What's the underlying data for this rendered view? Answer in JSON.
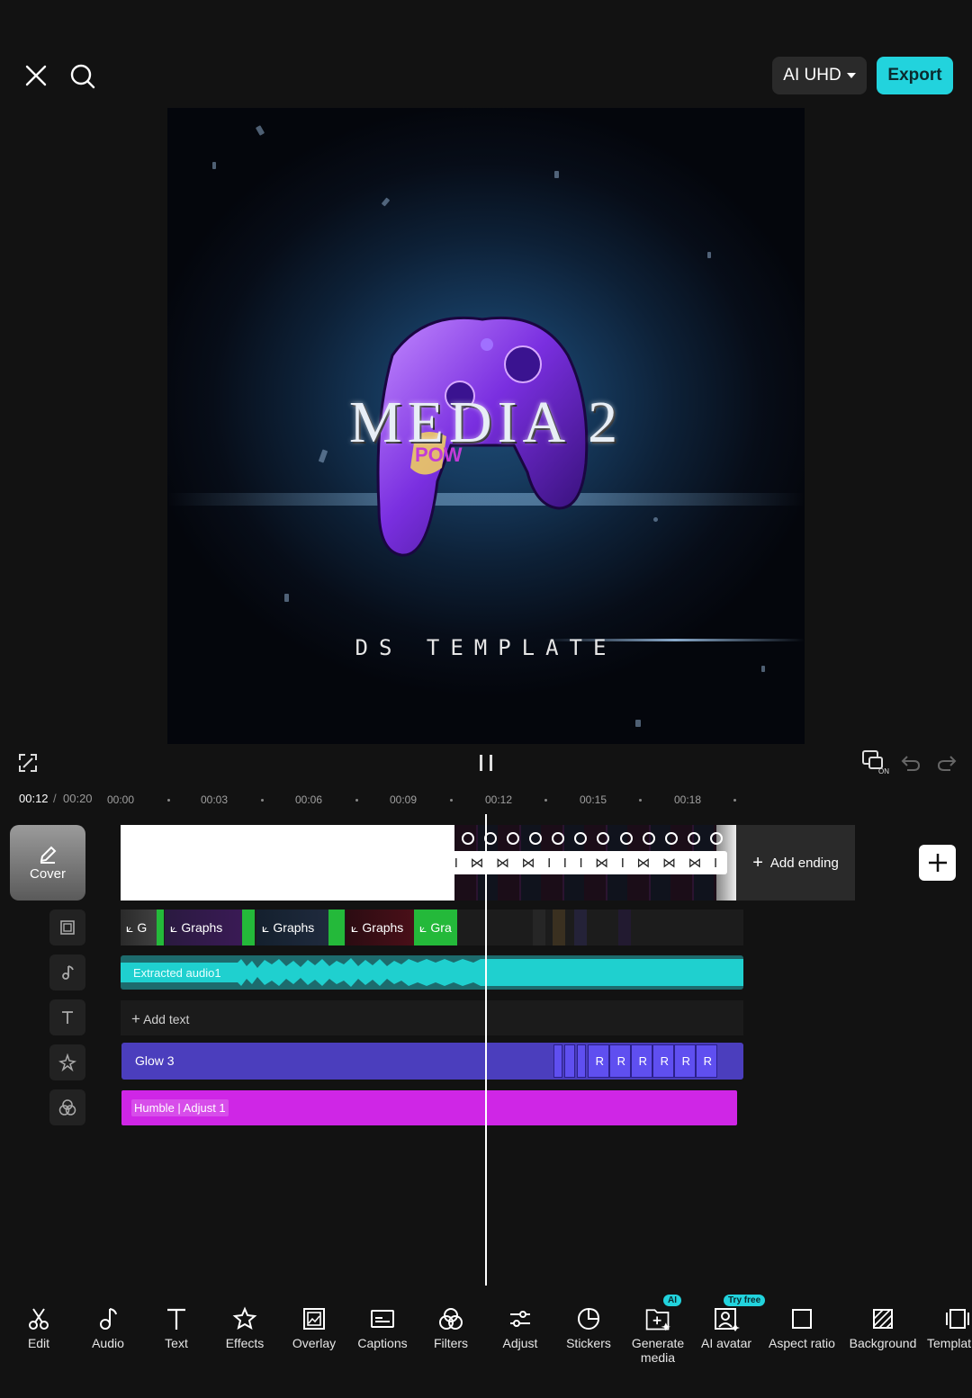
{
  "header": {
    "quality_label": "AI UHD",
    "export_label": "Export"
  },
  "preview": {
    "title_text": "MEDIA 2",
    "subtitle_text": "DS TEMPLATE"
  },
  "timeline": {
    "current_time": "00:12",
    "separator": "/",
    "total_time": "00:20",
    "ruler_ticks": [
      "00:00",
      "00:03",
      "00:06",
      "00:09",
      "00:12",
      "00:15",
      "00:18"
    ],
    "cover_label": "Cover",
    "add_ending_label": "Add ending",
    "overlay_clips": [
      "G",
      "Graphs",
      "Graphs",
      "Graphs",
      "Gra"
    ],
    "audio_label": "Extracted audio1",
    "add_text_label": "Add text",
    "effect_label": "Glow 3",
    "effect_marker": "R",
    "adjust_label": "Humble | Adjust 1"
  },
  "toolbar": {
    "items": [
      {
        "label": "Edit",
        "icon": "scissors-icon"
      },
      {
        "label": "Audio",
        "icon": "music-note-icon"
      },
      {
        "label": "Text",
        "icon": "text-t-icon"
      },
      {
        "label": "Effects",
        "icon": "star-sparkle-icon"
      },
      {
        "label": "Overlay",
        "icon": "overlay-image-icon"
      },
      {
        "label": "Captions",
        "icon": "captions-icon"
      },
      {
        "label": "Filters",
        "icon": "filters-circles-icon"
      },
      {
        "label": "Adjust",
        "icon": "sliders-icon"
      },
      {
        "label": "Stickers",
        "icon": "sticker-icon"
      },
      {
        "label": "Generate media",
        "icon": "generate-media-icon"
      },
      {
        "label": "AI avatar",
        "icon": "ai-avatar-icon"
      },
      {
        "label": "Aspect ratio",
        "icon": "aspect-ratio-icon"
      },
      {
        "label": "Background",
        "icon": "background-icon"
      },
      {
        "label": "Templat",
        "icon": "template-icon"
      }
    ],
    "ai_badge": "AI",
    "try_free_badge": "Try free"
  },
  "colors": {
    "accent": "#22d3dd",
    "effect_track": "#4b3ebd",
    "adjust_track": "#cf26e6",
    "audio_wave": "#1fd0cf",
    "overlay_green": "#24b93a"
  }
}
